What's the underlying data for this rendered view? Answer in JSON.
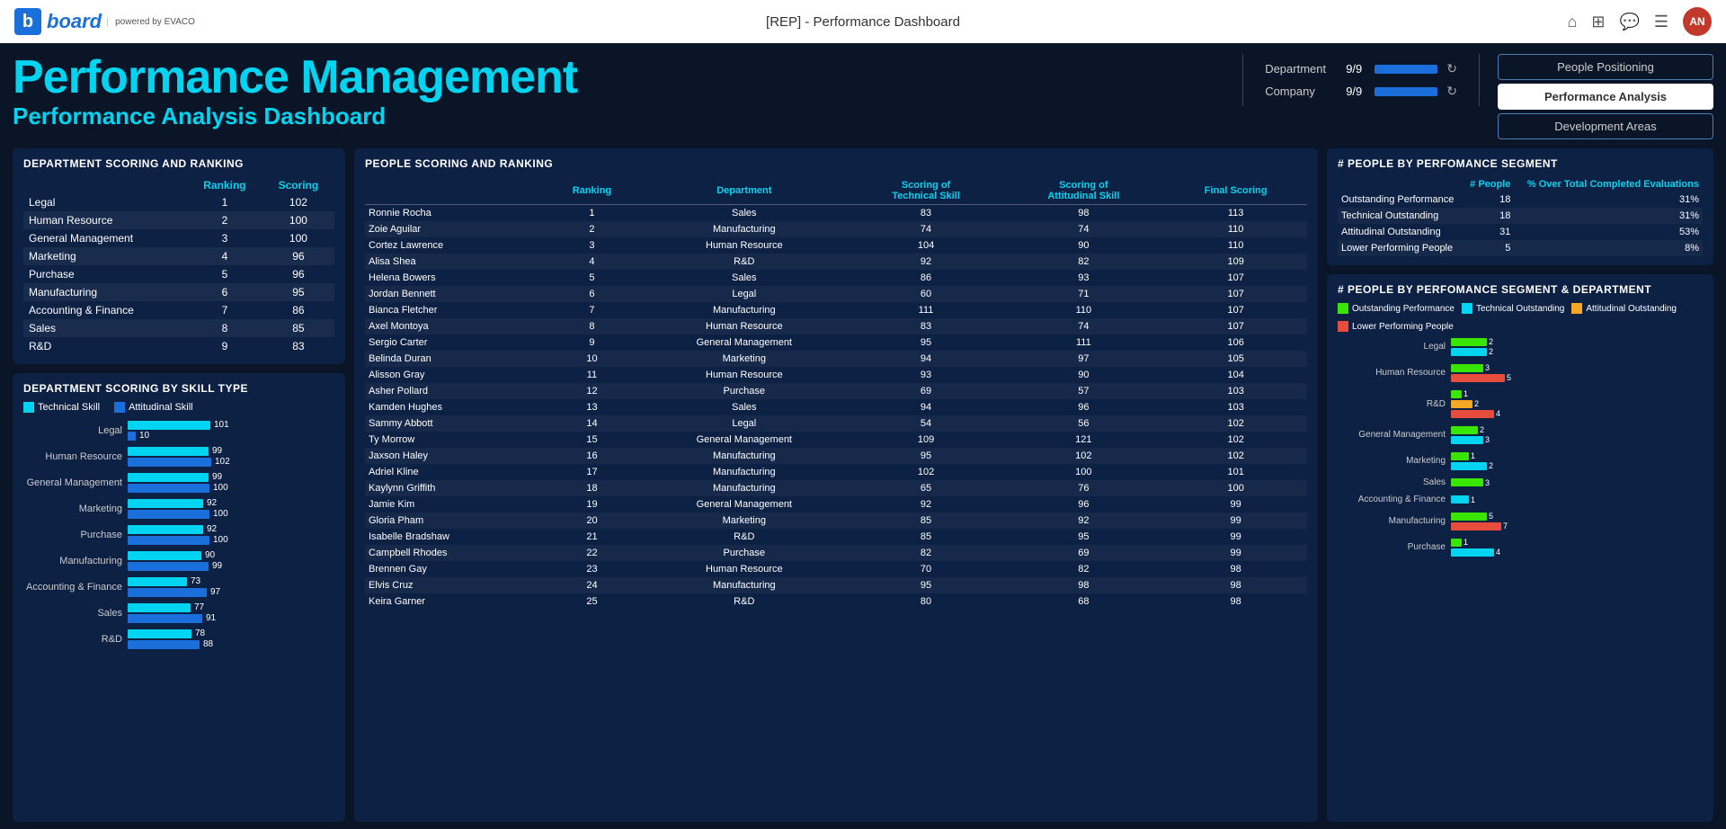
{
  "topbar": {
    "title": "[REP] - Performance Dashboard",
    "nav": {
      "people_positioning": "People Positioning",
      "performance_analysis": "Performance Analysis",
      "development_areas": "Development Areas"
    }
  },
  "header": {
    "main_title": "Performance Management",
    "sub_title": "Performance Analysis Dashboard",
    "department_label": "Department",
    "department_value": "9/9",
    "company_label": "Company",
    "company_value": "9/9"
  },
  "dept_scoring": {
    "title": "DEPARTMENT SCORING AND RANKING",
    "columns": [
      "",
      "Ranking",
      "Scoring"
    ],
    "rows": [
      {
        "dept": "Legal",
        "ranking": 1,
        "scoring": 102
      },
      {
        "dept": "Human Resource",
        "ranking": 2,
        "scoring": 100
      },
      {
        "dept": "General Management",
        "ranking": 3,
        "scoring": 100
      },
      {
        "dept": "Marketing",
        "ranking": 4,
        "scoring": 96
      },
      {
        "dept": "Purchase",
        "ranking": 5,
        "scoring": 96
      },
      {
        "dept": "Manufacturing",
        "ranking": 6,
        "scoring": 95
      },
      {
        "dept": "Accounting & Finance",
        "ranking": 7,
        "scoring": 86
      },
      {
        "dept": "Sales",
        "ranking": 8,
        "scoring": 85
      },
      {
        "dept": "R&D",
        "ranking": 9,
        "scoring": 83
      }
    ]
  },
  "skill_chart": {
    "title": "DEPARTMENT SCORING BY SKILL TYPE",
    "legend": [
      {
        "label": "Technical Skill",
        "color": "#00d4f0"
      },
      {
        "label": "Attitudinal Skill",
        "color": "#1a6fdb"
      }
    ],
    "rows": [
      {
        "dept": "Legal",
        "tech": 101,
        "att": 10,
        "tech_w": 92,
        "att_w": 9
      },
      {
        "dept": "Human Resource",
        "tech": 99,
        "att": 102,
        "tech_w": 90,
        "att_w": 93
      },
      {
        "dept": "General Management",
        "tech": 99,
        "att": 100,
        "tech_w": 90,
        "att_w": 91
      },
      {
        "dept": "Marketing",
        "tech": 92,
        "att": 100,
        "tech_w": 84,
        "att_w": 91
      },
      {
        "dept": "Purchase",
        "tech": 92,
        "att": 100,
        "tech_w": 84,
        "att_w": 91
      },
      {
        "dept": "Manufacturing",
        "tech": 90,
        "att": 99,
        "tech_w": 82,
        "att_w": 90
      },
      {
        "dept": "Accounting & Finance",
        "tech": 73,
        "att": 97,
        "tech_w": 66,
        "att_w": 88
      },
      {
        "dept": "Sales",
        "tech": 77,
        "att": 91,
        "tech_w": 70,
        "att_w": 83
      },
      {
        "dept": "R&D",
        "tech": 78,
        "att": 88,
        "tech_w": 71,
        "att_w": 80
      }
    ]
  },
  "people_scoring": {
    "title": "PEOPLE SCORING AND RANKING",
    "columns": [
      "Name",
      "Ranking",
      "Department",
      "Scoring of Technical Skill",
      "Scoring of Attitudinal Skill",
      "Final Scoring"
    ],
    "rows": [
      {
        "name": "Ronnie Rocha",
        "rank": 1,
        "dept": "Sales",
        "tech": 83,
        "att": 98,
        "final": 113
      },
      {
        "name": "Zoie Aguilar",
        "rank": 2,
        "dept": "Manufacturing",
        "tech": 74,
        "att": 74,
        "final": 110
      },
      {
        "name": "Cortez Lawrence",
        "rank": 3,
        "dept": "Human Resource",
        "tech": 104,
        "att": 90,
        "final": 110
      },
      {
        "name": "Alisa Shea",
        "rank": 4,
        "dept": "R&D",
        "tech": 92,
        "att": 82,
        "final": 109
      },
      {
        "name": "Helena Bowers",
        "rank": 5,
        "dept": "Sales",
        "tech": 86,
        "att": 93,
        "final": 107
      },
      {
        "name": "Jordan Bennett",
        "rank": 6,
        "dept": "Legal",
        "tech": 60,
        "att": 71,
        "final": 107
      },
      {
        "name": "Bianca Fletcher",
        "rank": 7,
        "dept": "Manufacturing",
        "tech": 111,
        "att": 110,
        "final": 107
      },
      {
        "name": "Axel Montoya",
        "rank": 8,
        "dept": "Human Resource",
        "tech": 83,
        "att": 74,
        "final": 107
      },
      {
        "name": "Sergio Carter",
        "rank": 9,
        "dept": "General Management",
        "tech": 95,
        "att": 111,
        "final": 106
      },
      {
        "name": "Belinda Duran",
        "rank": 10,
        "dept": "Marketing",
        "tech": 94,
        "att": 97,
        "final": 105
      },
      {
        "name": "Alisson Gray",
        "rank": 11,
        "dept": "Human Resource",
        "tech": 93,
        "att": 90,
        "final": 104
      },
      {
        "name": "Asher Pollard",
        "rank": 12,
        "dept": "Purchase",
        "tech": 69,
        "att": 57,
        "final": 103
      },
      {
        "name": "Kamden Hughes",
        "rank": 13,
        "dept": "Sales",
        "tech": 94,
        "att": 96,
        "final": 103
      },
      {
        "name": "Sammy Abbott",
        "rank": 14,
        "dept": "Legal",
        "tech": 54,
        "att": 56,
        "final": 102
      },
      {
        "name": "Ty Morrow",
        "rank": 15,
        "dept": "General Management",
        "tech": 109,
        "att": 121,
        "final": 102
      },
      {
        "name": "Jaxson Haley",
        "rank": 16,
        "dept": "Manufacturing",
        "tech": 95,
        "att": 102,
        "final": 102
      },
      {
        "name": "Adriel Kline",
        "rank": 17,
        "dept": "Manufacturing",
        "tech": 102,
        "att": 100,
        "final": 101
      },
      {
        "name": "Kaylynn Griffith",
        "rank": 18,
        "dept": "Manufacturing",
        "tech": 65,
        "att": 76,
        "final": 100
      },
      {
        "name": "Jamie Kim",
        "rank": 19,
        "dept": "General Management",
        "tech": 92,
        "att": 96,
        "final": 99
      },
      {
        "name": "Gloria Pham",
        "rank": 20,
        "dept": "Marketing",
        "tech": 85,
        "att": 92,
        "final": 99
      },
      {
        "name": "Isabelle Bradshaw",
        "rank": 21,
        "dept": "R&D",
        "tech": 85,
        "att": 95,
        "final": 99
      },
      {
        "name": "Campbell Rhodes",
        "rank": 22,
        "dept": "Purchase",
        "tech": 82,
        "att": 69,
        "final": 99
      },
      {
        "name": "Brennen Gay",
        "rank": 23,
        "dept": "Human Resource",
        "tech": 70,
        "att": 82,
        "final": 98
      },
      {
        "name": "Elvis Cruz",
        "rank": 24,
        "dept": "Manufacturing",
        "tech": 95,
        "att": 98,
        "final": 98
      },
      {
        "name": "Keira Garner",
        "rank": 25,
        "dept": "R&D",
        "tech": 80,
        "att": 68,
        "final": 98
      }
    ]
  },
  "perf_segment": {
    "title": "# PEOPLE BY PERFOMANCE SEGMENT",
    "col_people": "# People",
    "col_pct": "% Over Total Completed Evaluations",
    "rows": [
      {
        "label": "Outstanding Performance",
        "people": 18,
        "pct": "31%"
      },
      {
        "label": "Technical Outstanding",
        "people": 18,
        "pct": "31%"
      },
      {
        "label": "Attitudinal Outstanding",
        "people": 31,
        "pct": "53%"
      },
      {
        "label": "Lower Performing People",
        "people": 5,
        "pct": "8%"
      }
    ]
  },
  "perf_segment_dept": {
    "title": "# PEOPLE BY PERFOMANCE SEGMENT & DEPARTMENT",
    "legend": [
      {
        "label": "Outstanding Performance",
        "color": "#39e600"
      },
      {
        "label": "Technical Outstanding",
        "color": "#00d4f0"
      },
      {
        "label": "Attitudinal Outstanding",
        "color": "#f5a623"
      },
      {
        "label": "Lower Performing People",
        "color": "#e74c3c"
      }
    ],
    "rows": [
      {
        "dept": "Legal",
        "outstanding": 2,
        "tech_out": 2,
        "att_out": 0,
        "lower": 0,
        "out_w": 40,
        "tech_w": 40,
        "att_w": 0,
        "lower_w": 0
      },
      {
        "dept": "Human Resource",
        "outstanding": 3,
        "tech_out": 0,
        "att_out": 0,
        "lower": 5,
        "out_w": 36,
        "tech_w": 0,
        "att_w": 0,
        "lower_w": 60
      },
      {
        "dept": "R&D",
        "outstanding": 1,
        "tech_out": 0,
        "att_out": 2,
        "lower": 4,
        "out_w": 12,
        "tech_w": 0,
        "att_w": 24,
        "lower_w": 48
      },
      {
        "dept": "General Management",
        "outstanding": 2,
        "tech_out": 3,
        "att_out": 0,
        "lower": 0,
        "out_w": 30,
        "tech_w": 36,
        "att_w": 0,
        "lower_w": 0
      },
      {
        "dept": "Marketing",
        "outstanding": 1,
        "tech_out": 2,
        "att_out": 0,
        "lower": 0,
        "out_w": 20,
        "tech_w": 40,
        "att_w": 0,
        "lower_w": 0
      },
      {
        "dept": "Sales",
        "outstanding": 3,
        "tech_out": 0,
        "att_out": 0,
        "lower": 0,
        "out_w": 36,
        "tech_w": 0,
        "att_w": 0,
        "lower_w": 0
      },
      {
        "dept": "Accounting & Finance",
        "outstanding": 0,
        "tech_out": 1,
        "att_out": 0,
        "lower": 0,
        "out_w": 0,
        "tech_w": 20,
        "att_w": 0,
        "lower_w": 0
      },
      {
        "dept": "Manufacturing",
        "outstanding": 5,
        "tech_out": 0,
        "att_out": 0,
        "lower": 7,
        "out_w": 40,
        "tech_w": 0,
        "att_w": 0,
        "lower_w": 56
      },
      {
        "dept": "Purchase",
        "outstanding": 1,
        "tech_out": 4,
        "att_out": 0,
        "lower": 0,
        "out_w": 12,
        "tech_w": 48,
        "att_w": 0,
        "lower_w": 0
      }
    ]
  }
}
